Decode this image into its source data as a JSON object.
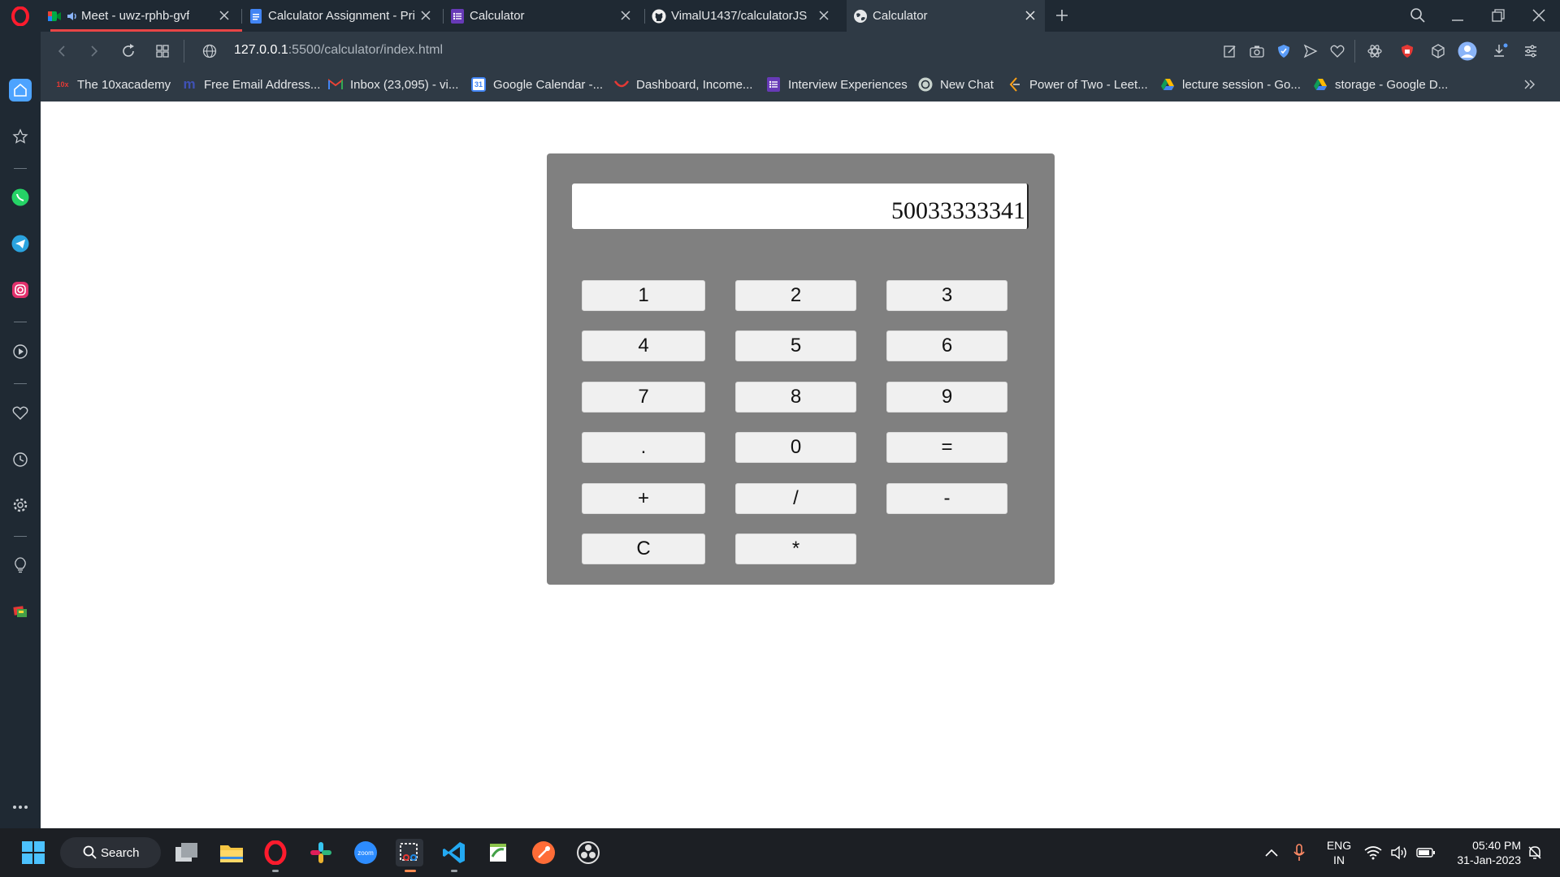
{
  "browser": {
    "tabs": [
      {
        "title": "Meet - uwz-rphb-gvf",
        "icon": "google-meet-icon",
        "audio": true
      },
      {
        "title": "Calculator Assignment - Pri",
        "icon": "google-docs-icon"
      },
      {
        "title": "Calculator",
        "icon": "google-forms-icon"
      },
      {
        "title": "VimalU1437/calculatorJS",
        "icon": "github-icon"
      },
      {
        "title": "Calculator",
        "icon": "globe-icon",
        "active": true
      }
    ],
    "url_host": "127.0.0.1",
    "url_path": ":5500/calculator/index.html",
    "bookmarks": [
      {
        "label": "The 10xacademy",
        "icon": "10x-icon",
        "color": "#e53935"
      },
      {
        "label": "Free Email Address...",
        "icon": "m-icon",
        "color": "#3f51b5"
      },
      {
        "label": "Inbox (23,095) - vi...",
        "icon": "gmail-icon",
        "color": "#ea4335"
      },
      {
        "label": "Google Calendar -...",
        "icon": "calendar-icon",
        "color": "#4285f4"
      },
      {
        "label": "Dashboard, Income...",
        "icon": "dashboard-icon",
        "color": "#e53935"
      },
      {
        "label": "Interview Experiences",
        "icon": "forms-icon",
        "color": "#673ab7"
      },
      {
        "label": "New Chat",
        "icon": "chatgpt-icon",
        "color": "#ffffff"
      },
      {
        "label": "Power of Two - Leet...",
        "icon": "leetcode-icon",
        "color": "#ffa116"
      },
      {
        "label": "lecture session - Go...",
        "icon": "drive-icon",
        "color": "#34a853"
      },
      {
        "label": "storage - Google D...",
        "icon": "drive-icon",
        "color": "#34a853"
      }
    ]
  },
  "calculator": {
    "display": "50033333341",
    "keys": [
      [
        "1",
        "2",
        "3"
      ],
      [
        "4",
        "5",
        "6"
      ],
      [
        "7",
        "8",
        "9"
      ],
      [
        ".",
        "0",
        "="
      ],
      [
        "+",
        "/",
        "-"
      ],
      [
        "C",
        "*"
      ]
    ]
  },
  "taskbar": {
    "search_label": "Search",
    "language_line1": "ENG",
    "language_line2": "IN",
    "time": "05:40 PM",
    "date": "31-Jan-2023"
  }
}
